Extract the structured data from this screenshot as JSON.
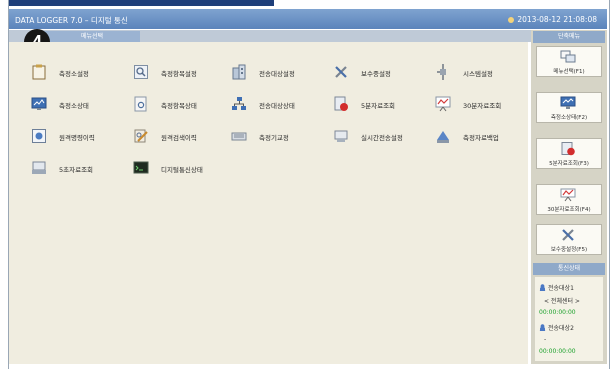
{
  "title_bar": {
    "title": "DATA LOGGER 7.0 – 디지털 통신",
    "datetime": "2013-08-12 21:08:08"
  },
  "badge": {
    "number": "4"
  },
  "tabs": {
    "menu_tab": "메뉴선택"
  },
  "menu": {
    "items": [
      {
        "label": "측정소설정",
        "icon": "clipboard-icon"
      },
      {
        "label": "측정항목설정",
        "icon": "magnifier-doc-icon"
      },
      {
        "label": "전송대상설정",
        "icon": "building-icon"
      },
      {
        "label": "보수중설정",
        "icon": "tools-icon"
      },
      {
        "label": "시스템설정",
        "icon": "plug-icon"
      },
      {
        "label": "측정소상태",
        "icon": "monitor-icon"
      },
      {
        "label": "측정항목상태",
        "icon": "doc-search-icon"
      },
      {
        "label": "전송대상상태",
        "icon": "network-icon"
      },
      {
        "label": "5분자료조회",
        "icon": "db-red-icon"
      },
      {
        "label": "30분자료조회",
        "icon": "chart-board-icon"
      },
      {
        "label": "원격명령이력",
        "icon": "remote-doc-icon"
      },
      {
        "label": "원격검색이력",
        "icon": "pen-search-icon"
      },
      {
        "label": "측정기교정",
        "icon": "calibration-icon"
      },
      {
        "label": "실시간전송설정",
        "icon": "realtime-icon"
      },
      {
        "label": "측정자료백업",
        "icon": "backup-icon"
      },
      {
        "label": "5초자료조회",
        "icon": "scanner-icon"
      },
      {
        "label": "디지털통신상태",
        "icon": "terminal-icon"
      }
    ]
  },
  "quick_menu": {
    "header": "단축메뉴",
    "items": [
      {
        "label": "메뉴선택(F1)",
        "icon": "windows-icon"
      },
      {
        "label": "측정소상태(F2)",
        "icon": "monitor-icon"
      },
      {
        "label": "5분자료조회(F3)",
        "icon": "db-red-icon"
      },
      {
        "label": "30분자료조회(F4)",
        "icon": "chart-board-icon"
      },
      {
        "label": "보수중설정(F5)",
        "icon": "tools-icon"
      }
    ]
  },
  "comm_status": {
    "header": "통신상태",
    "targets": [
      {
        "name": "전송대상1",
        "sub": "< 전체센터 >",
        "time": "00:00:00:00"
      },
      {
        "name": "전송대상2",
        "sub": "-",
        "time": "00:00:00:00"
      }
    ]
  }
}
